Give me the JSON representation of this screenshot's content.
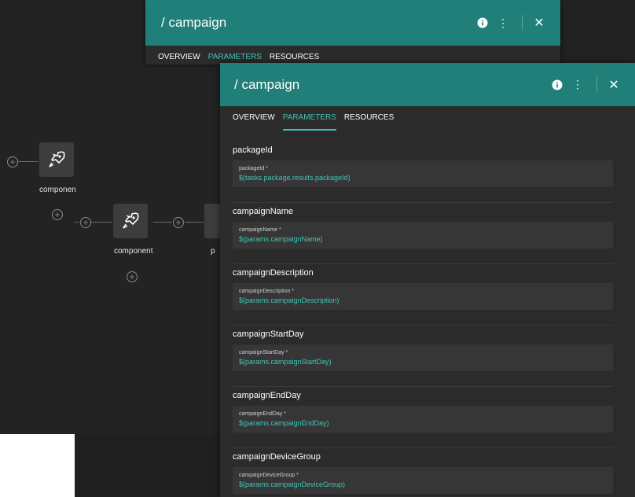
{
  "canvas": {
    "node1_label": "componen",
    "node2_label": "component",
    "node3_label": "p"
  },
  "back_panel": {
    "title": "/ campaign",
    "tabs": [
      "OVERVIEW",
      "PARAMETERS",
      "RESOURCES"
    ]
  },
  "panel": {
    "title": "/ campaign",
    "tabs": [
      "OVERVIEW",
      "PARAMETERS",
      "RESOURCES"
    ],
    "active_tab": "PARAMETERS",
    "params": [
      {
        "name": "packageId",
        "label": "packageId *",
        "value": "$(tasks.package.results.packageId)"
      },
      {
        "name": "campaignName",
        "label": "campaignName *",
        "value": "$(params.campaignName)"
      },
      {
        "name": "campaignDescription",
        "label": "campaignDescription *",
        "value": "$(params.campaignDescription)"
      },
      {
        "name": "campaignStartDay",
        "label": "campaignStartDay *",
        "value": "$(params.campaignStartDay)"
      },
      {
        "name": "campaignEndDay",
        "label": "campaignEndDay *",
        "value": "$(params.campaignEndDay)"
      },
      {
        "name": "campaignDeviceGroup",
        "label": "campaignDeviceGroup *",
        "value": "$(params.campaignDeviceGroup)"
      }
    ]
  },
  "colors": {
    "header": "#217f79",
    "accent": "#3fc6b6",
    "panel_bg": "#2b2b2b",
    "canvas_bg": "#232323"
  },
  "icons": {
    "node": "rocket-icon",
    "info": "info-icon",
    "menu": "more-vert-icon",
    "close": "close-icon",
    "add": "plus-circle-icon"
  }
}
